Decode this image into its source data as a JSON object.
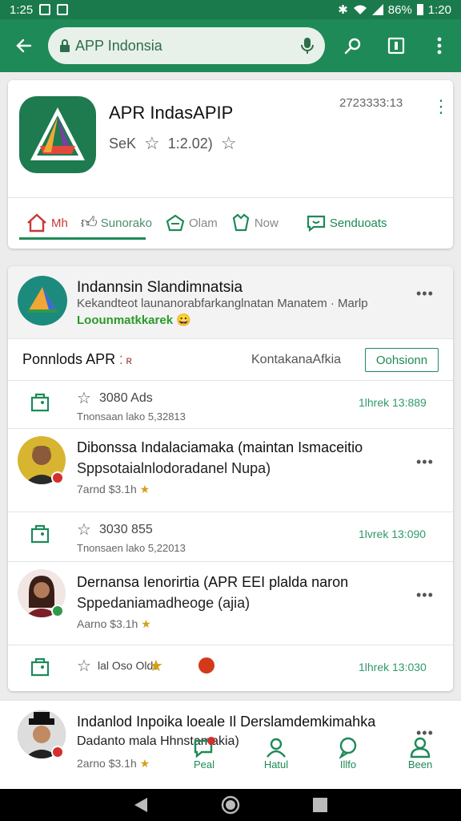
{
  "status": {
    "time": "1:25",
    "battery": "86%",
    "clock": "1:20"
  },
  "appbar": {
    "search_text": "APP Indonsia"
  },
  "app": {
    "title": "APR IndasAPIP",
    "sub_left": "SeK",
    "rating": "1:2.02)",
    "code": "2723333:13"
  },
  "tabs": [
    {
      "label": "Mh",
      "icon": "home-icon"
    },
    {
      "label": "Sunorako",
      "icon": "thumbs-up-icon"
    },
    {
      "label": "Olam",
      "icon": "shop-icon"
    },
    {
      "label": "Now",
      "icon": "bag-icon"
    },
    {
      "label": "Senduoats",
      "icon": "chat-icon"
    }
  ],
  "group": {
    "title": "Indannsin Slandimnatsia",
    "desc": "Kekandteot launanorabfarkanglnatan Manatem · Marlp",
    "tag": "Loounmatkkarek 😀"
  },
  "downloads": {
    "title": "Ponnlods APR",
    "title_suffix": "⁚ ʀ",
    "right": "KontakanaAfkia",
    "button": "Oohsionn"
  },
  "rows": [
    {
      "title": "3080 Ads",
      "sub": "Tnonsaan lako 5,32813",
      "time": "1lhrek 13:889"
    },
    {
      "title": "3030 855",
      "sub": "Tnonsaen lako 5,22013",
      "time": "1lvrek 13:090"
    },
    {
      "title": "lal  Oso  Olda",
      "sub": "",
      "time": "1lhrek 13:030"
    }
  ],
  "posts": [
    {
      "line1": "Dibonssa Indalaciamaka (maintan Ismaceitio",
      "line2": "Sppsotaialnlodoradanel Nupa)",
      "meta": "7arnd $3.1h",
      "badge": "#d32f2f"
    },
    {
      "line1": "Dernansa Ienorirtia (APR EEI plalda naron",
      "line2": "Sppedaniamadheoge (ajia)",
      "meta": "Aarno $3.1h",
      "badge": "#2e9a48"
    },
    {
      "line1": "Indanlod Inpoika loeale Il Derslamdemkimahka",
      "line2": "Dadanto mala Hhnstamakia)",
      "meta": "2arno $3.1h",
      "badge": "#d32f2f"
    }
  ],
  "bottomnav": [
    {
      "label": "Peal",
      "icon": "chat-icon"
    },
    {
      "label": "Hatul",
      "icon": "people-icon"
    },
    {
      "label": "Illfo",
      "icon": "chat-bubble-icon"
    },
    {
      "label": "Been",
      "icon": "person-icon"
    }
  ],
  "colors": {
    "primary": "#1e8a57",
    "accent": "#c73838"
  }
}
